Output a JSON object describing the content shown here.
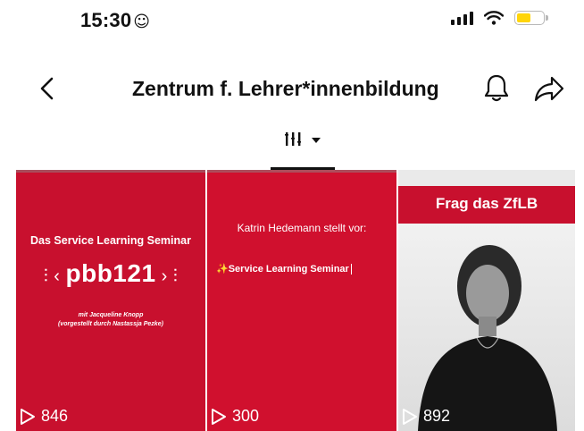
{
  "status_bar": {
    "time": "15:30",
    "time_emoji": "☺",
    "battery_level": 0.55,
    "battery_color": "#ffd50a"
  },
  "header": {
    "title": "Zentrum f. Lehrer*innenbildung",
    "back_icon": "chevron-left-icon",
    "bell_icon": "bell-icon",
    "share_icon": "share-icon"
  },
  "tabs": {
    "active": "filter-tab",
    "icon": "vertical-bars-icon"
  },
  "videos": [
    {
      "heading": "Das Service Learning Seminar",
      "brand": "pbb121",
      "sub1": "mit Jacqueline Knopp",
      "sub2": "(vorgestellt durch Nastassja Pezke)",
      "views": "846"
    },
    {
      "heading": "Katrin Hedemann stellt vor:",
      "sparkle": "✨",
      "seminar": "Service Learning Seminar",
      "views": "300"
    },
    {
      "banner": "Frag das ZfLB",
      "views": "892"
    }
  ],
  "colors": {
    "brand_red": "#c8102e",
    "text_dark": "#111111"
  }
}
